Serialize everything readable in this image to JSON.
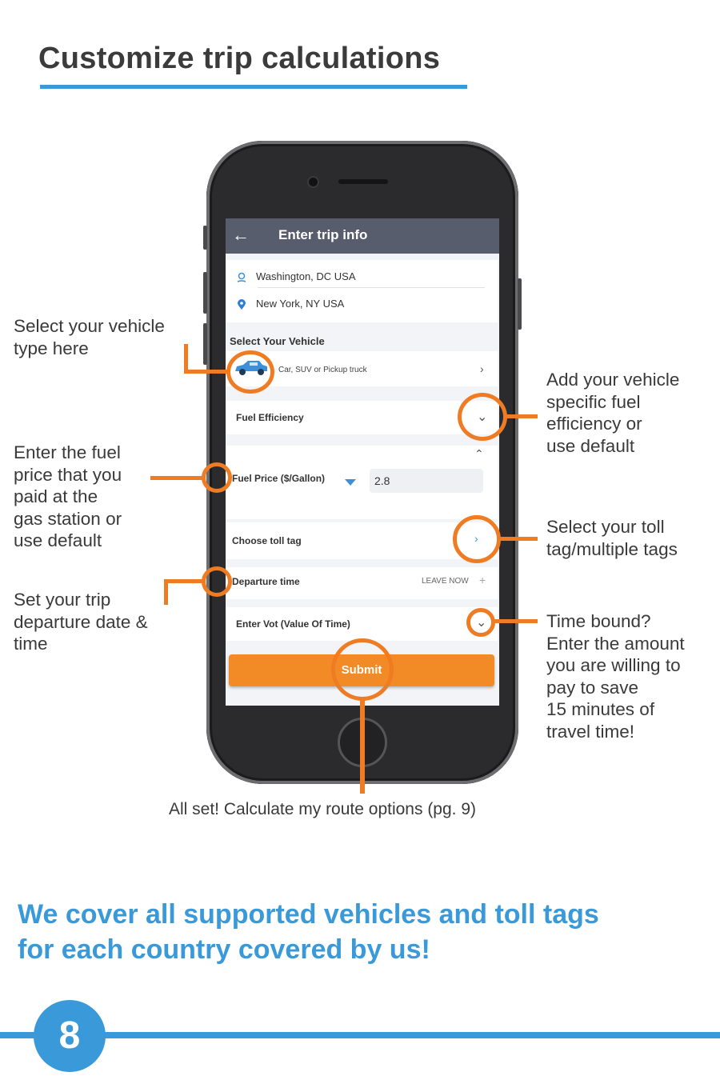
{
  "page": {
    "title": "Customize trip calculations",
    "bottom_caption": "All set! Calculate my route options (pg. 9)",
    "tagline_line1": "We cover all supported vehicles and toll tags",
    "tagline_line2": "for each country covered by us!",
    "page_number": "8"
  },
  "app": {
    "header_title": "Enter trip info",
    "origin": "Washington, DC USA",
    "destination": "New York, NY USA",
    "vehicle_section_label": "Select Your Vehicle",
    "vehicle_value": "Car, SUV or Pickup truck",
    "fuel_efficiency_label": "Fuel Efficiency",
    "fuel_price_label": "Fuel Price ($/Gallon)",
    "fuel_price_value": "2.8",
    "toll_tag_label": "Choose toll tag",
    "departure_label": "Departure time",
    "departure_value": "LEAVE NOW",
    "vot_label": "Enter Vot (Value Of Time)",
    "submit_label": "Submit"
  },
  "callouts": {
    "vehicle": [
      "Select your vehicle",
      "type here"
    ],
    "fuel_price": [
      "Enter the fuel",
      "price that you",
      "paid at the",
      "gas station or",
      "use default"
    ],
    "departure": [
      "Set your trip",
      "departure date &",
      "time"
    ],
    "fuel_efficiency": [
      "Add your vehicle",
      "specific fuel",
      "efficiency or",
      "use default"
    ],
    "toll_tag": [
      "Select your toll",
      "tag/multiple tags"
    ],
    "vot": [
      "Time bound?",
      "Enter the amount",
      "you are willing to",
      "pay to save",
      "15 minutes of",
      "travel time!"
    ]
  },
  "colors": {
    "accent_blue": "#3a9ad9",
    "callout_orange": "#ef7b23",
    "submit_orange": "#f28a25",
    "app_bar": "#585d6e"
  }
}
